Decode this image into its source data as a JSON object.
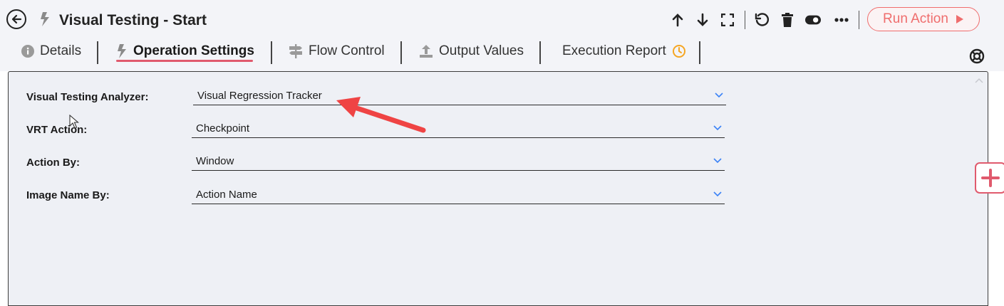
{
  "header": {
    "title": "Visual Testing - Start",
    "run_button": {
      "label": "Run Action"
    }
  },
  "tabs": [
    {
      "label": "Details"
    },
    {
      "label": "Operation Settings",
      "active": true
    },
    {
      "label": "Flow Control"
    },
    {
      "label": "Output Values"
    },
    {
      "label": "Execution Report"
    }
  ],
  "form": {
    "fields": [
      {
        "label": "Visual Testing Analyzer:",
        "value": "Visual Regression Tracker"
      },
      {
        "label": "VRT Action:",
        "value": "Checkpoint"
      },
      {
        "label": "Action By:",
        "value": "Window"
      },
      {
        "label": "Image Name By:",
        "value": "Action Name"
      }
    ]
  },
  "colors": {
    "accent": "#e05a6d",
    "run_button": "#ef6d6d",
    "annotation_arrow": "#ef4444",
    "chevron": "#3b82f6",
    "clock": "#f5a623",
    "panel_bg": "#eef0f5"
  },
  "icons": [
    "back-arrow-icon",
    "bolt-icon",
    "arrow-up-icon",
    "arrow-down-icon",
    "expand-icon",
    "undo-icon",
    "trash-icon",
    "toggle-icon",
    "more-icon",
    "play-icon",
    "info-icon",
    "signpost-icon",
    "upload-icon",
    "clock-icon",
    "lifebuoy-icon",
    "chevron-down-icon",
    "plus-icon",
    "mouse-cursor-icon"
  ]
}
